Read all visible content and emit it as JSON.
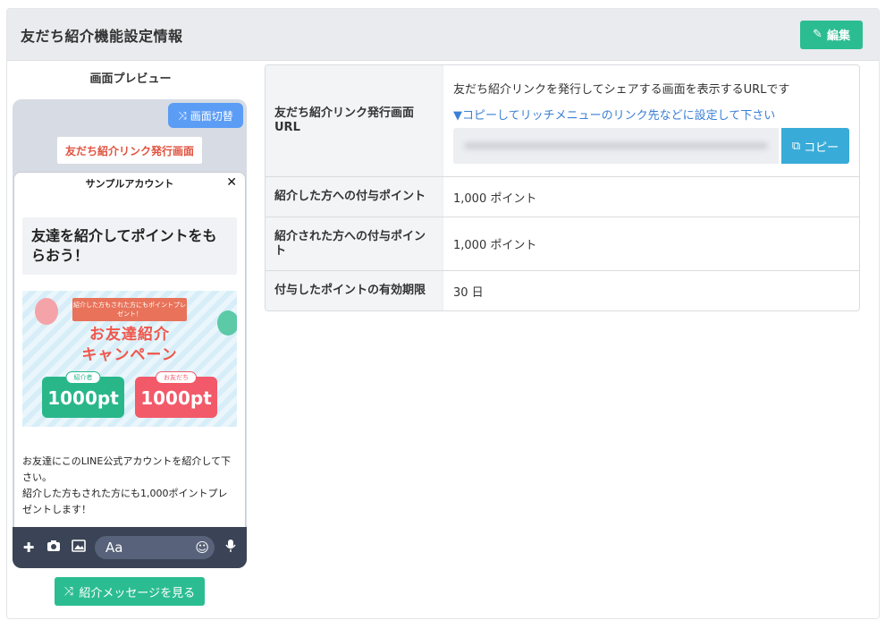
{
  "header": {
    "title": "友だち紹介機能設定情報",
    "edit_label": "編集"
  },
  "preview": {
    "title": "画面プレビュー",
    "switch_label": "画面切替",
    "richmenu_link_label": "友だち紹介リンク発行画面",
    "chat": {
      "account_name": "サンプルアカウント",
      "heading": "友達を紹介してポイントをもらおう！",
      "banner": {
        "ribbon": "紹介した方もされた方にもポイントプレゼント！",
        "title_line1": "お友達紹介",
        "title_line2": "キャンペーン",
        "referrer_label": "紹介者",
        "referrer_points": "1000pt",
        "friend_label": "お友だち",
        "friend_points": "1000pt"
      },
      "body_line1": "お友達にこのLINE公式アカウントを紹介して下さい。",
      "body_line2": "紹介した方もされた方にも1,000ポイントプレゼントします！",
      "input_placeholder": "Aa"
    },
    "view_message_label": "紹介メッセージを見る"
  },
  "info": {
    "url_label": "友だち紹介リンク発行画面URL",
    "url_desc": "友だち紹介リンクを発行してシェアする画面を表示するURLです",
    "url_hint": "▼コピーしてリッチメニューのリンク先などに設定して下さい",
    "copy_label": "コピー",
    "referrer_points_label": "紹介した方への付与ポイント",
    "referrer_points_value": "1,000 ポイント",
    "referred_points_label": "紹介された方への付与ポイント",
    "referred_points_value": "1,000 ポイント",
    "expiry_label": "付与したポイントの有効期限",
    "expiry_value": "30 日"
  },
  "colors": {
    "primary_green": "#2bbd91",
    "copy_blue": "#38abd9",
    "switch_blue": "#5b9cf5",
    "link_blue": "#3a7fd6",
    "chat_footer": "#3b4456"
  },
  "icons": [
    "pencil-icon",
    "shuffle-icon",
    "close-icon",
    "plus-icon",
    "camera-icon",
    "image-icon",
    "emoji-icon",
    "mic-icon",
    "copy-icon"
  ]
}
